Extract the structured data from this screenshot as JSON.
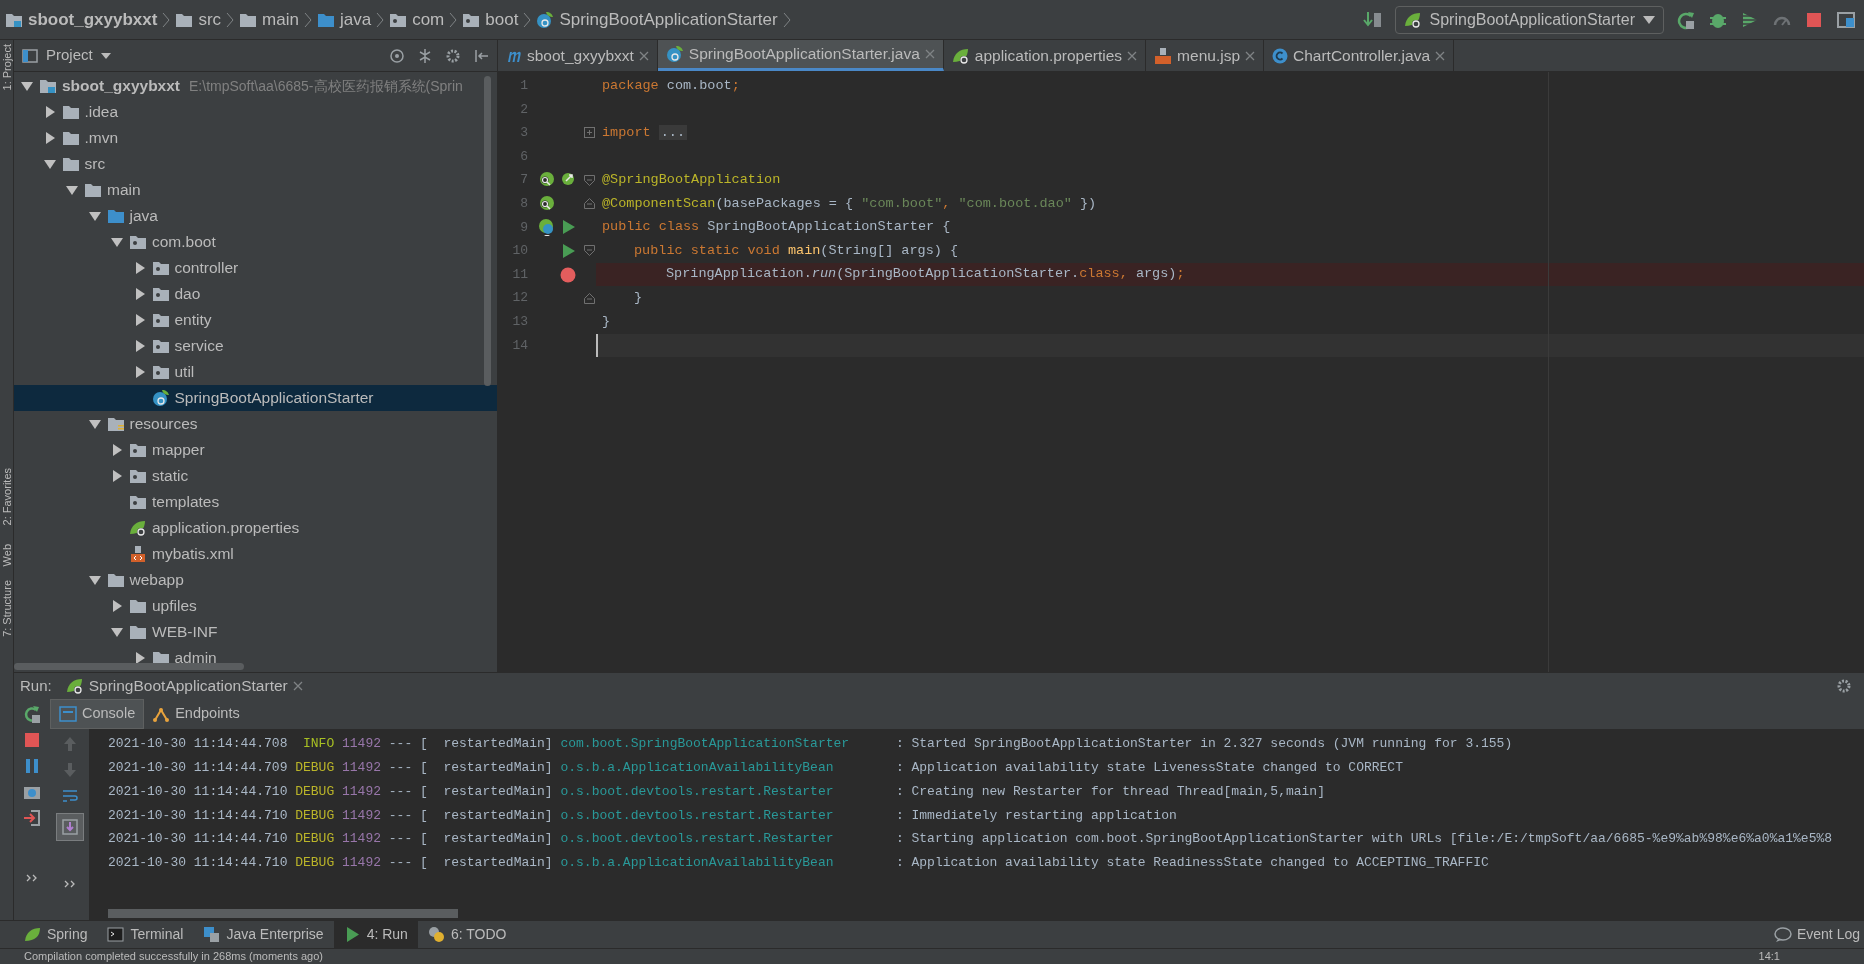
{
  "breadcrumb": [
    {
      "label": "sboot_gxyybxxt",
      "kind": "project"
    },
    {
      "label": "src",
      "kind": "folder"
    },
    {
      "label": "main",
      "kind": "folder"
    },
    {
      "label": "java",
      "kind": "source"
    },
    {
      "label": "com",
      "kind": "package"
    },
    {
      "label": "boot",
      "kind": "package"
    },
    {
      "label": "SpringBootApplicationStarter",
      "kind": "spring"
    }
  ],
  "run_config": "SpringBootApplicationStarter",
  "side_tools": [
    "1: Project",
    "2: Favorites",
    "Web",
    "7: Structure"
  ],
  "project_panel": {
    "title": "Project",
    "tree": [
      {
        "label": "sboot_gxyybxxt",
        "path": "E:\\tmpSoft\\aa\\6685-高校医药报销系统(Sprin",
        "kind": "project",
        "expanded": true,
        "selected": false,
        "children": [
          {
            "label": ".idea",
            "kind": "folder",
            "expanded": false,
            "selected": false
          },
          {
            "label": ".mvn",
            "kind": "folder",
            "expanded": false,
            "selected": false
          },
          {
            "label": "src",
            "kind": "folder",
            "expanded": true,
            "selected": false,
            "children": [
              {
                "label": "main",
                "kind": "folder",
                "expanded": true,
                "selected": false,
                "children": [
                  {
                    "label": "java",
                    "kind": "source",
                    "expanded": true,
                    "selected": false,
                    "children": [
                      {
                        "label": "com.boot",
                        "kind": "package",
                        "expanded": true,
                        "selected": false,
                        "children": [
                          {
                            "label": "controller",
                            "kind": "package",
                            "expanded": false,
                            "selected": false
                          },
                          {
                            "label": "dao",
                            "kind": "package",
                            "expanded": false,
                            "selected": false
                          },
                          {
                            "label": "entity",
                            "kind": "package",
                            "expanded": false,
                            "selected": false
                          },
                          {
                            "label": "service",
                            "kind": "package",
                            "expanded": false,
                            "selected": false
                          },
                          {
                            "label": "util",
                            "kind": "package",
                            "expanded": false,
                            "selected": false
                          },
                          {
                            "label": "SpringBootApplicationStarter",
                            "kind": "spring",
                            "selected": true
                          }
                        ]
                      }
                    ]
                  },
                  {
                    "label": "resources",
                    "kind": "resources",
                    "expanded": true,
                    "selected": false,
                    "children": [
                      {
                        "label": "mapper",
                        "kind": "package",
                        "expanded": false,
                        "selected": false
                      },
                      {
                        "label": "static",
                        "kind": "package",
                        "expanded": false,
                        "selected": false
                      },
                      {
                        "label": "templates",
                        "kind": "package",
                        "selected": false
                      },
                      {
                        "label": "application.properties",
                        "kind": "properties",
                        "selected": false
                      },
                      {
                        "label": "mybatis.xml",
                        "kind": "xml",
                        "selected": false
                      }
                    ]
                  },
                  {
                    "label": "webapp",
                    "kind": "folder",
                    "expanded": true,
                    "selected": false,
                    "children": [
                      {
                        "label": "upfiles",
                        "kind": "folder",
                        "expanded": false,
                        "selected": false
                      },
                      {
                        "label": "WEB-INF",
                        "kind": "folder",
                        "expanded": true,
                        "selected": false,
                        "children": [
                          {
                            "label": "admin",
                            "kind": "folder",
                            "expanded": false,
                            "selected": false
                          }
                        ]
                      }
                    ]
                  }
                ]
              }
            ]
          }
        ]
      }
    ]
  },
  "editor_tabs": [
    {
      "label": "sboot_gxyybxxt",
      "kind": "module",
      "selected": false
    },
    {
      "label": "SpringBootApplicationStarter.java",
      "kind": "spring",
      "selected": true
    },
    {
      "label": "application.properties",
      "kind": "properties",
      "selected": false
    },
    {
      "label": "menu.jsp",
      "kind": "jsp",
      "selected": false
    },
    {
      "label": "ChartController.java",
      "kind": "class",
      "selected": false
    }
  ],
  "code_lines": [
    {
      "number": "1",
      "tokens": [
        {
          "kind": "keyword",
          "text": "package "
        },
        {
          "kind": "plain",
          "text": "com.boot"
        },
        {
          "kind": "keyword",
          "text": ";"
        }
      ]
    },
    {
      "number": "2"
    },
    {
      "number": "3",
      "fold": {
        "kind": "plus"
      },
      "tokens": [
        {
          "kind": "keyword",
          "text": "import "
        },
        {
          "kind": "folded",
          "text": "..."
        }
      ]
    },
    {
      "number": "6"
    },
    {
      "number": "7",
      "fold": {
        "kind": "open"
      },
      "gutter": [
        {
          "kind": "bean"
        },
        {
          "kind": "navigate"
        }
      ],
      "tokens": [
        {
          "kind": "annotation",
          "text": "@SpringBootApplication"
        }
      ]
    },
    {
      "number": "8",
      "fold": {
        "kind": "close"
      },
      "gutter": [
        {
          "kind": "bean"
        }
      ],
      "tokens": [
        {
          "kind": "annotation",
          "text": "@ComponentScan"
        },
        {
          "kind": "plain",
          "text": "(basePackages = { "
        },
        {
          "kind": "string",
          "text": "\"com.boot\""
        },
        {
          "kind": "keyword",
          "text": ", "
        },
        {
          "kind": "string",
          "text": "\"com.boot.dao\""
        },
        {
          "kind": "plain",
          "text": " })"
        }
      ]
    },
    {
      "number": "9",
      "gutter": [
        {
          "kind": "spring"
        },
        {
          "kind": "run"
        }
      ],
      "tokens": [
        {
          "kind": "keyword",
          "text": "public class "
        },
        {
          "kind": "plain",
          "text": "SpringBootApplicationStarter {"
        }
      ]
    },
    {
      "number": "10",
      "fold": {
        "kind": "open"
      },
      "gutter": [
        {
          "kind": "run"
        }
      ],
      "tokens": [
        {
          "kind": "indent"
        },
        {
          "kind": "keyword",
          "text": "public static void "
        },
        {
          "kind": "method",
          "text": "main"
        },
        {
          "kind": "plain",
          "text": "(String[] args) {"
        }
      ]
    },
    {
      "number": "11",
      "breakpoint": true,
      "tokens": [
        {
          "kind": "indent"
        },
        {
          "kind": "indent"
        },
        {
          "kind": "plain",
          "text": "SpringApplication."
        },
        {
          "kind": "static",
          "text": "run"
        },
        {
          "kind": "plain",
          "text": "(SpringBootApplicationStarter."
        },
        {
          "kind": "keyword",
          "text": "class"
        },
        {
          "kind": "keyword",
          "text": ", "
        },
        {
          "kind": "plain",
          "text": "args)"
        },
        {
          "kind": "keyword",
          "text": ";"
        }
      ]
    },
    {
      "number": "12",
      "fold": {
        "kind": "close"
      },
      "tokens": [
        {
          "kind": "indent"
        },
        {
          "kind": "plain",
          "text": "}"
        }
      ]
    },
    {
      "number": "13",
      "tokens": [
        {
          "kind": "plain",
          "text": "}"
        }
      ]
    },
    {
      "number": "14",
      "current": true
    }
  ],
  "run_panel": {
    "label": "Run:",
    "tab": "SpringBootApplicationStarter",
    "subtabs": [
      {
        "label": "Console",
        "kind": "console",
        "selected": true
      },
      {
        "label": "Endpoints",
        "kind": "endpoints",
        "selected": false
      }
    ],
    "log": [
      {
        "time": "2021-10-30 11:14:44.708",
        "level": "INFO",
        "pid": "11492",
        "sep": "---",
        "thread": "[  restartedMain]",
        "logger": "com.boot.SpringBootApplicationStarter",
        "message": ": Started SpringBootApplicationStarter in 2.327 seconds (JVM running for 3.155)"
      },
      {
        "time": "2021-10-30 11:14:44.709",
        "level": "DEBUG",
        "pid": "11492",
        "sep": "---",
        "thread": "[  restartedMain]",
        "logger": "o.s.b.a.ApplicationAvailabilityBean",
        "message": ": Application availability state LivenessState changed to CORRECT"
      },
      {
        "time": "2021-10-30 11:14:44.710",
        "level": "DEBUG",
        "pid": "11492",
        "sep": "---",
        "thread": "[  restartedMain]",
        "logger": "o.s.boot.devtools.restart.Restarter",
        "message": ": Creating new Restarter for thread Thread[main,5,main]"
      },
      {
        "time": "2021-10-30 11:14:44.710",
        "level": "DEBUG",
        "pid": "11492",
        "sep": "---",
        "thread": "[  restartedMain]",
        "logger": "o.s.boot.devtools.restart.Restarter",
        "message": ": Immediately restarting application"
      },
      {
        "time": "2021-10-30 11:14:44.710",
        "level": "DEBUG",
        "pid": "11492",
        "sep": "---",
        "thread": "[  restartedMain]",
        "logger": "o.s.boot.devtools.restart.Restarter",
        "message": ": Starting application com.boot.SpringBootApplicationStarter with URLs [file:/E:/tmpSoft/aa/6685-%e9%ab%98%e6%a0%a1%e5%8"
      },
      {
        "time": "2021-10-30 11:14:44.710",
        "level": "DEBUG",
        "pid": "11492",
        "sep": "---",
        "thread": "[  restartedMain]",
        "logger": "o.s.b.a.ApplicationAvailabilityBean",
        "message": ": Application availability state ReadinessState changed to ACCEPTING_TRAFFIC"
      }
    ]
  },
  "bottom_tools": [
    {
      "label": "Spring",
      "kind": "spring",
      "selected": false
    },
    {
      "label": "Terminal",
      "kind": "terminal",
      "selected": false
    },
    {
      "label": "Java Enterprise",
      "kind": "enterprise",
      "selected": false
    },
    {
      "label": "4: Run",
      "kind": "run",
      "selected": true
    },
    {
      "label": "6: TODO",
      "kind": "todo",
      "selected": false
    }
  ],
  "event_log": "Event Log",
  "status_bar": {
    "message": "Compilation completed successfully in 268ms (moments ago)",
    "position": "14:1"
  }
}
